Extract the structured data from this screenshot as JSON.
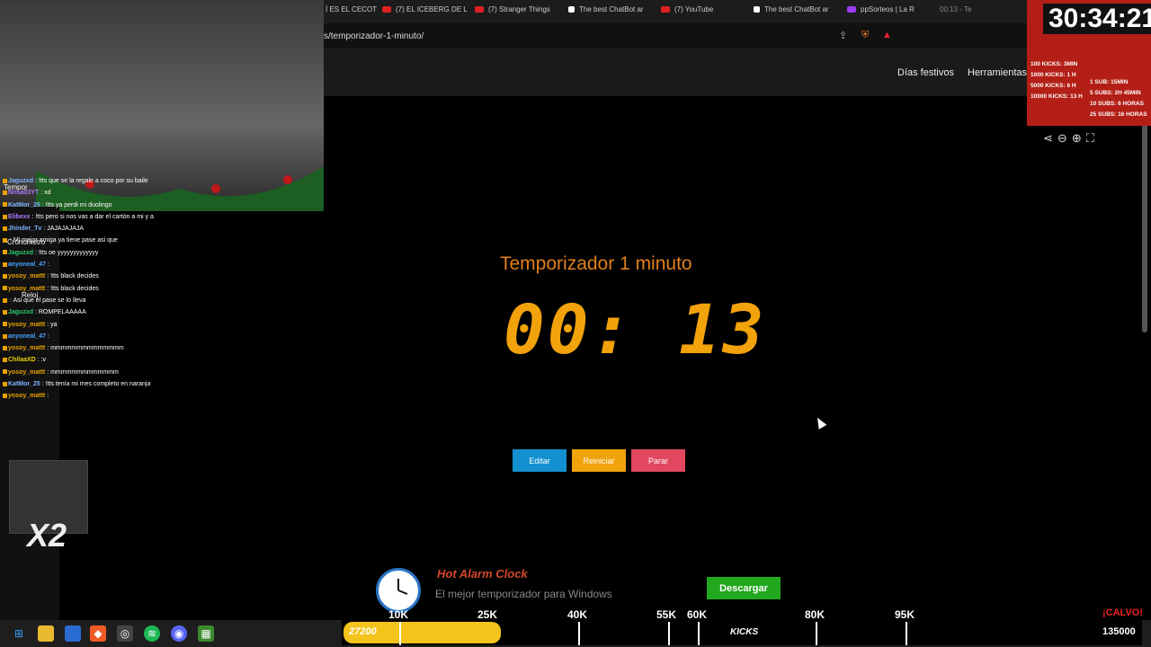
{
  "browser": {
    "tabs": [
      "Í ES EL CECOT",
      "(7) EL ICEBERG DE L",
      "(7) Stranger Things",
      "The best ChatBot ar",
      "(7) YouTube",
      "The best ChatBot ar",
      "ppSorteos | La R",
      "00:13 - Te"
    ],
    "url": "s/temporizador-1-minuto/"
  },
  "site": {
    "nav": [
      "Días festivos",
      "Herramientas"
    ]
  },
  "timer": {
    "title": "Temporizador 1 minuto",
    "display": "00: 13",
    "buttons": {
      "edit": "Editar",
      "reset": "Reiniciar",
      "stop": "Parar"
    }
  },
  "ad": {
    "title": "Hot Alarm Clock",
    "subtitle": "El mejor temporizador para Windows",
    "download": "Descargar"
  },
  "stream": {
    "subathon_clock": "30:34:21",
    "goals_left": [
      "100 KICKS: 3MIN",
      "1000 KICKS: 1 H",
      "5000 KICKS: 6 H",
      "10000 KICKS: 13 H"
    ],
    "goals_right": [
      "1 SUB: 15MIN",
      "5 SUBS: 2H 45MIN",
      "10 SUBS: 6 HORAS",
      "25 SUBS: 16 HORAS"
    ],
    "progress_current": "27200",
    "progress_marks": [
      "10K",
      "25K",
      "40K",
      "55K",
      "60K",
      "80K",
      "95K"
    ],
    "progress_label": "KICKS",
    "progress_total": "135000",
    "progress_fraction": 0.2,
    "calvo": "¡CALVO!",
    "x2": "X2",
    "overlay_labels": [
      "Tempor",
      "Cronometro",
      "Reloj"
    ]
  },
  "chat": [
    {
      "user": "Jaguzxd",
      "msg": ": !tts que se la regale a coco por su baile",
      "color": "#7fb3ff"
    },
    {
      "user": "Nrisa03YT",
      "msg": ": xd",
      "color": "#b07bff"
    },
    {
      "user": "KatMor_25",
      "msg": ": !tts ya perdi mi duolingo",
      "color": "#7fb3ff"
    },
    {
      "user": "Elibexx",
      "msg": ": !tts pero si nos vas a dar el cartón a mi y a",
      "color": "#b07bff"
    },
    {
      "user": "Jhinder_Tv",
      "msg": ": JAJAJAJAJA",
      "color": "#7fb3ff"
    },
    {
      "user": "",
      "msg": ": Mi mejor amiga ya tiene pase asi que",
      "color": "#e0302a"
    },
    {
      "user": "Jaguzxd",
      "msg": ": !tts oe yyyyyyyyyyyyy",
      "color": "#2ecc71"
    },
    {
      "user": "anyoneal_47",
      "msg": ":",
      "color": "#4aa3ff"
    },
    {
      "user": "yosoy_mattt",
      "msg": ": !tts black decides",
      "color": "#e8a100"
    },
    {
      "user": "yosoy_mattt",
      "msg": ": !tts black decides",
      "color": "#e8a100"
    },
    {
      "user": "",
      "msg": ": Asi que el pase se lo lleva",
      "color": "#e0302a"
    },
    {
      "user": "Jaguzxd",
      "msg": ": ROMPELAAAAA",
      "color": "#2ecc71"
    },
    {
      "user": "yosoy_mattt",
      "msg": ": ya",
      "color": "#e8a100"
    },
    {
      "user": "anyoneal_47",
      "msg": ":",
      "color": "#4aa3ff"
    },
    {
      "user": "yosoy_mattt",
      "msg": ": mmmmmmmmmmmmmm",
      "color": "#e8a100"
    },
    {
      "user": "ChilaaXD",
      "msg": ": :v",
      "color": "#f0d000"
    },
    {
      "user": "yosoy_mattt",
      "msg": ": mmmmmmmmmmmmm",
      "color": "#e8a100"
    },
    {
      "user": "KatMor_25",
      "msg": ": !tts tenía mi mes completo en naranja",
      "color": "#7fb3ff"
    },
    {
      "user": "yosoy_mattt",
      "msg": ":",
      "color": "#e8a100"
    }
  ],
  "colors": {
    "accent_orange": "#f2a20a",
    "edit": "#1290cf",
    "reset": "#f1a30c",
    "stop": "#e1485f",
    "download": "#22a81e",
    "overlay_red": "#b31f16"
  },
  "icons": [
    "share-icon",
    "zoom-out-icon",
    "zoom-in-icon",
    "fullscreen-icon"
  ]
}
